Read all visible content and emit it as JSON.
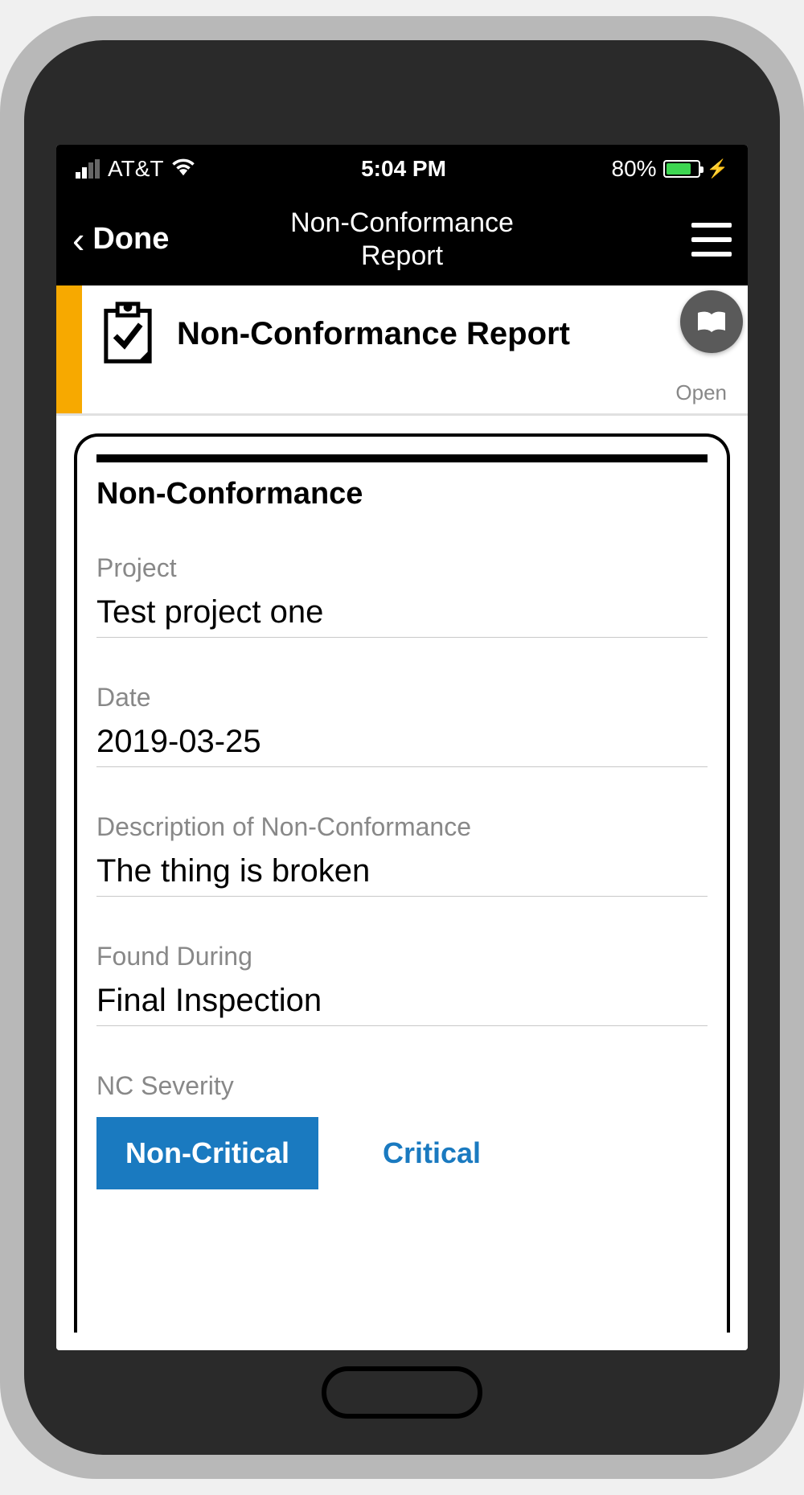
{
  "status_bar": {
    "carrier": "AT&T",
    "time": "5:04 PM",
    "battery_pct": "80%"
  },
  "nav": {
    "back_label": "Done",
    "title": "Non-Conformance Report"
  },
  "header": {
    "title": "Non-Conformance Report",
    "status": "Open"
  },
  "form": {
    "section_heading": "Non-Conformance",
    "fields": {
      "project": {
        "label": "Project",
        "value": "Test project one"
      },
      "date": {
        "label": "Date",
        "value": "2019-03-25"
      },
      "description": {
        "label": "Description of Non-Conformance",
        "value": "The thing is broken"
      },
      "found_during": {
        "label": "Found During",
        "value": "Final Inspection"
      },
      "severity": {
        "label": "NC Severity",
        "options": {
          "non_critical": "Non-Critical",
          "critical": "Critical"
        },
        "selected": "non_critical"
      }
    }
  }
}
